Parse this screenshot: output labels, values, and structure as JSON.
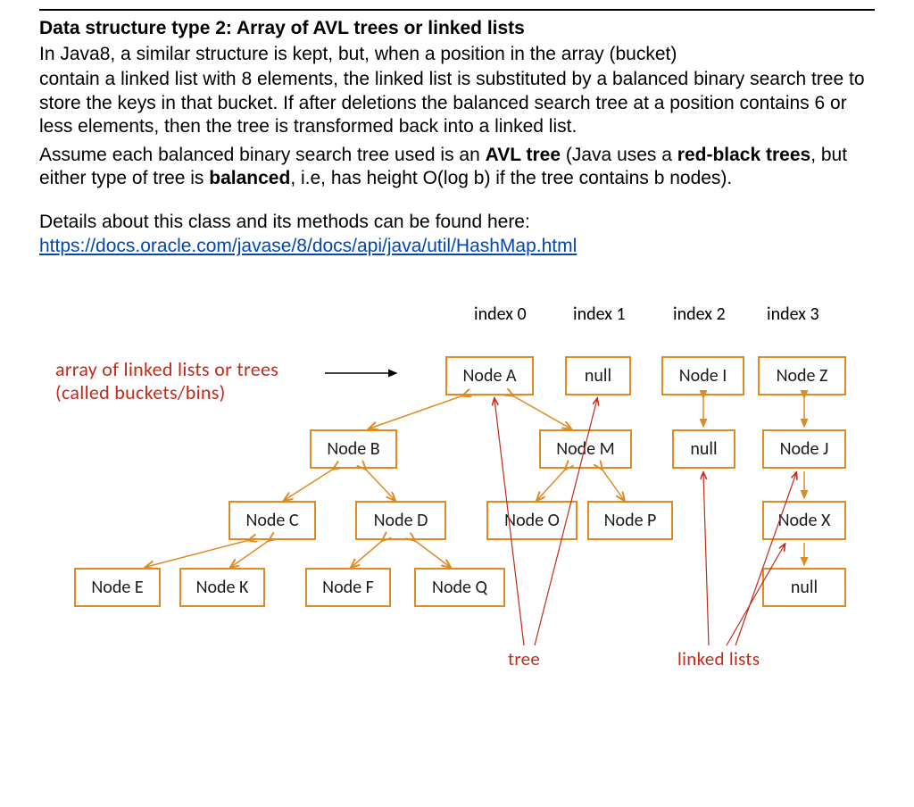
{
  "heading": "Data structure type 2: Array of AVL trees or linked lists",
  "para1": "In Java8, a similar structure is kept, but, when a position in the array (bucket)",
  "para2": "contain a linked list with 8 elements, the linked list is substituted by a balanced binary search tree to store the keys in that bucket. If after deletions the balanced search tree at a position contains 6 or less elements, then the tree is transformed back into a linked list.",
  "para3_a": "Assume each balanced binary search tree used is an ",
  "para3_b": "AVL tree",
  "para3_c": " (Java uses a ",
  "para3_d": "red-black trees",
  "para3_e": ", but either type of tree is ",
  "para3_f": "balanced",
  "para3_g": ", i.e, has height O(log b) if the tree contains b nodes).",
  "para4": "Details about this class and its methods can be found here:",
  "link": "https://docs.oracle.com/javase/8/docs/api/java/util/HashMap.html",
  "diagram": {
    "idx0": "index 0",
    "idx1": "index 1",
    "idx2": "index 2",
    "idx3": "index 3",
    "label_top": "array of linked lists or trees",
    "label_sub": "(called buckets/bins)",
    "tree_lbl": "tree",
    "ll_lbl": "linked lists",
    "nA": "Node A",
    "nNull1": "null",
    "nI": "Node I",
    "nZ": "Node Z",
    "nB": "Node B",
    "nM": "Node M",
    "nNull2": "null",
    "nJ": "Node J",
    "nC": "Node C",
    "nD": "Node D",
    "nO": "Node O",
    "nP": "Node P",
    "nX": "Node X",
    "nE": "Node E",
    "nK": "Node K",
    "nF": "Node F",
    "nQ": "Node Q",
    "nNull3": "null"
  }
}
